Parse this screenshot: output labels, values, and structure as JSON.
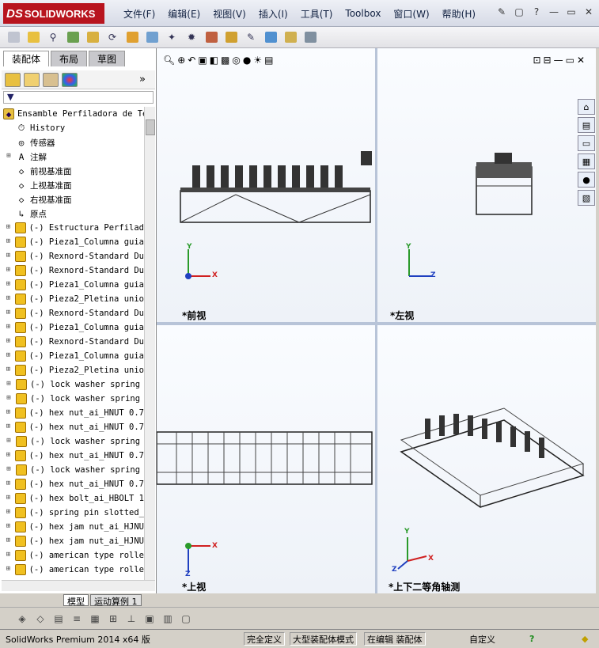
{
  "app": {
    "logo_prefix": "DS",
    "logo_name": "SOLIDWORKS"
  },
  "menu": [
    "文件(F)",
    "编辑(E)",
    "视图(V)",
    "插入(I)",
    "工具(T)",
    "Toolbox",
    "窗口(W)",
    "帮助(H)"
  ],
  "panel": {
    "tabs": [
      "装配体",
      "布局",
      "草图"
    ],
    "root": "Ensamble Perfiladora de Te",
    "items": [
      {
        "expand": "",
        "icon": "history-icon",
        "label": "History"
      },
      {
        "expand": "",
        "icon": "sensor-icon",
        "label": "传感器"
      },
      {
        "expand": "+",
        "icon": "annotation-icon",
        "label": "注解"
      },
      {
        "expand": "",
        "icon": "plane-icon",
        "label": "前视基准面"
      },
      {
        "expand": "",
        "icon": "plane-icon",
        "label": "上视基准面"
      },
      {
        "expand": "",
        "icon": "plane-icon",
        "label": "右视基准面"
      },
      {
        "expand": "",
        "icon": "origin-icon",
        "label": "原点"
      },
      {
        "expand": "+",
        "icon": "part-icon",
        "label": "(-) Estructura Perfilad"
      },
      {
        "expand": "+",
        "icon": "part-icon",
        "label": "(-) Pieza1_Columna guia"
      },
      {
        "expand": "+",
        "icon": "part-icon",
        "label": "(-) Rexnord-Standard Du"
      },
      {
        "expand": "+",
        "icon": "part-icon",
        "label": "(-) Rexnord-Standard Du"
      },
      {
        "expand": "+",
        "icon": "part-icon",
        "label": "(-) Pieza1_Columna guia"
      },
      {
        "expand": "+",
        "icon": "part-icon",
        "label": "(-) Pieza2_Pletina unio"
      },
      {
        "expand": "+",
        "icon": "part-icon",
        "label": "(-) Rexnord-Standard Du"
      },
      {
        "expand": "+",
        "icon": "part-icon",
        "label": "(-) Pieza1_Columna guia"
      },
      {
        "expand": "+",
        "icon": "part-icon",
        "label": "(-) Rexnord-Standard Du"
      },
      {
        "expand": "+",
        "icon": "part-icon",
        "label": "(-) Pieza1_Columna guia"
      },
      {
        "expand": "+",
        "icon": "part-icon",
        "label": "(-) Pieza2_Pletina unio"
      },
      {
        "expand": "+",
        "icon": "part-icon",
        "label": "(-) lock washer spring"
      },
      {
        "expand": "+",
        "icon": "part-icon",
        "label": "(-) lock washer spring"
      },
      {
        "expand": "+",
        "icon": "part-icon",
        "label": "(-) hex nut_ai_HNUT 0.7"
      },
      {
        "expand": "+",
        "icon": "part-icon",
        "label": "(-) hex nut_ai_HNUT 0.7"
      },
      {
        "expand": "+",
        "icon": "part-icon",
        "label": "(-) lock washer spring"
      },
      {
        "expand": "+",
        "icon": "part-icon",
        "label": "(-) hex nut_ai_HNUT 0.7"
      },
      {
        "expand": "+",
        "icon": "part-icon",
        "label": "(-) lock washer spring"
      },
      {
        "expand": "+",
        "icon": "part-icon",
        "label": "(-) hex nut_ai_HNUT 0.7"
      },
      {
        "expand": "+",
        "icon": "part-icon",
        "label": "(-) hex bolt_ai_HBOLT 1"
      },
      {
        "expand": "+",
        "icon": "part-icon",
        "label": "(-) spring pin slotted_"
      },
      {
        "expand": "+",
        "icon": "part-icon",
        "label": "(-) hex jam nut_ai_HJNU"
      },
      {
        "expand": "+",
        "icon": "part-icon",
        "label": "(-) hex jam nut_ai_HJNU"
      },
      {
        "expand": "+",
        "icon": "part-icon",
        "label": "(-) american type rolle"
      },
      {
        "expand": "+",
        "icon": "part-icon",
        "label": "(-) american type rolle"
      }
    ],
    "bottom_tabs": [
      "模型",
      "运动算例 1"
    ]
  },
  "views": {
    "front": "*前视",
    "left": "*左视",
    "top": "*上视",
    "iso": "*上下二等角轴测"
  },
  "axes": {
    "x": "X",
    "y": "Y",
    "z": "Z"
  },
  "status": {
    "version": "SolidWorks Premium 2014 x64 版",
    "defined": "完全定义",
    "large_asm": "大型装配体模式",
    "editing": "在编辑 装配体",
    "custom": "自定义"
  }
}
